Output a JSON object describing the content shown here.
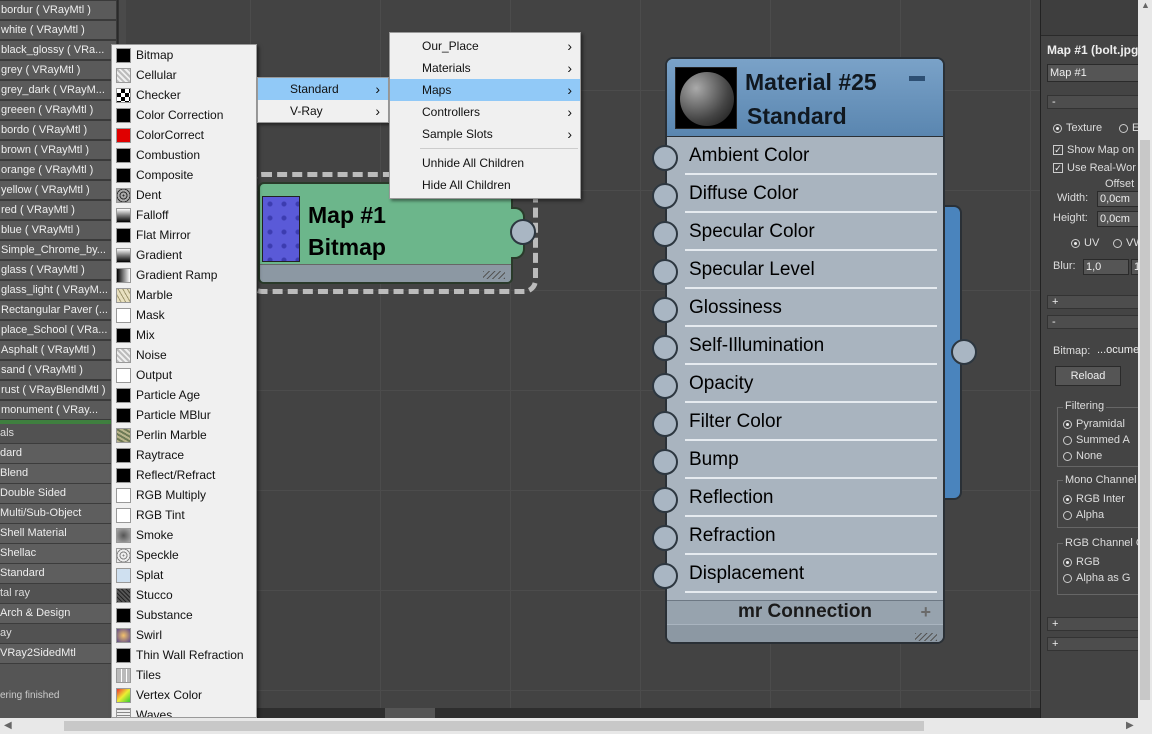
{
  "left_list": {
    "materials": [
      "bordur  ( VRayMtl )",
      "white  ( VRayMtl )",
      "black_glossy  ( VRa...",
      "grey  ( VRayMtl )",
      "grey_dark  ( VRayM...",
      "greeen  ( VRayMtl )",
      "bordo  ( VRayMtl )",
      "brown  ( VRayMtl )",
      "orange  ( VRayMtl )",
      "yellow  ( VRayMtl )",
      "red  ( VRayMtl )",
      "blue  ( VRayMtl )",
      "Simple_Chrome_by...",
      "glass  ( VRayMtl )",
      "glass_light  ( VRayM...",
      "Rectangular Paver  (...",
      "place_School  ( VRa...",
      "Asphalt  ( VRayMtl )",
      "sand  ( VRayMtl )",
      "rust  ( VRayBlendMtl )",
      "monument  ( VRay..."
    ],
    "categories": [
      {
        "label": "als",
        "sub": false
      },
      {
        "label": "dard",
        "sub": true
      },
      {
        "label": "Blend",
        "sub": true
      },
      {
        "label": "Double Sided",
        "sub": true
      },
      {
        "label": "Multi/Sub-Object",
        "sub": true
      },
      {
        "label": "Shell Material",
        "sub": true
      },
      {
        "label": "Shellac",
        "sub": true
      },
      {
        "label": "Standard",
        "sub": true
      },
      {
        "label": "tal ray",
        "sub": false
      },
      {
        "label": "Arch & Design",
        "sub": true
      },
      {
        "label": "ay",
        "sub": false
      },
      {
        "label": "VRay2SidedMtl",
        "sub": true
      }
    ],
    "status": "ering finished"
  },
  "maps_menu": [
    {
      "label": "Bitmap",
      "swatch": "black"
    },
    {
      "label": "Cellular",
      "swatch": "noise"
    },
    {
      "label": "Checker",
      "swatch": "checker"
    },
    {
      "label": "Color Correction",
      "swatch": "black"
    },
    {
      "label": "ColorCorrect",
      "swatch": "red"
    },
    {
      "label": "Combustion",
      "swatch": "black"
    },
    {
      "label": "Composite",
      "swatch": "black"
    },
    {
      "label": "Dent",
      "swatch": "dent"
    },
    {
      "label": "Falloff",
      "swatch": "gradv"
    },
    {
      "label": "Flat Mirror",
      "swatch": "black"
    },
    {
      "label": "Gradient",
      "swatch": "gradv"
    },
    {
      "label": "Gradient Ramp",
      "swatch": "grad"
    },
    {
      "label": "Marble",
      "swatch": "marble"
    },
    {
      "label": "Mask",
      "swatch": "mask"
    },
    {
      "label": "Mix",
      "swatch": "black"
    },
    {
      "label": "Noise",
      "swatch": "noise"
    },
    {
      "label": "Output",
      "swatch": "white"
    },
    {
      "label": "Particle Age",
      "swatch": "black"
    },
    {
      "label": "Particle MBlur",
      "swatch": "black"
    },
    {
      "label": "Perlin Marble",
      "swatch": "perlin"
    },
    {
      "label": "Raytrace",
      "swatch": "black"
    },
    {
      "label": "Reflect/Refract",
      "swatch": "black"
    },
    {
      "label": "RGB Multiply",
      "swatch": "white"
    },
    {
      "label": "RGB Tint",
      "swatch": "white"
    },
    {
      "label": "Smoke",
      "swatch": "smoke"
    },
    {
      "label": "Speckle",
      "swatch": "speckle"
    },
    {
      "label": "Splat",
      "swatch": "splat"
    },
    {
      "label": "Stucco",
      "swatch": "stucco"
    },
    {
      "label": "Substance",
      "swatch": "black"
    },
    {
      "label": "Swirl",
      "swatch": "swirl"
    },
    {
      "label": "Thin Wall Refraction",
      "swatch": "black"
    },
    {
      "label": "Tiles",
      "swatch": "tiles"
    },
    {
      "label": "Vertex Color",
      "swatch": "vertex"
    },
    {
      "label": "Waves",
      "swatch": "waves"
    }
  ],
  "submenu_category": [
    {
      "label": "Standard",
      "highlighted": true
    },
    {
      "label": "V-Ray",
      "highlighted": false
    }
  ],
  "context_menu": {
    "items": [
      {
        "label": "Our_Place",
        "highlighted": false
      },
      {
        "label": "Materials",
        "highlighted": false
      },
      {
        "label": "Maps",
        "highlighted": true
      },
      {
        "label": "Controllers",
        "highlighted": false
      },
      {
        "label": "Sample Slots",
        "highlighted": false
      }
    ],
    "actions": [
      "Unhide All Children",
      "Hide All Children"
    ]
  },
  "material_node": {
    "title": "Material #25",
    "type": "Standard",
    "slots": [
      "Ambient Color",
      "Diffuse Color",
      "Specular Color",
      "Specular Level",
      "Glossiness",
      "Self-Illumination",
      "Opacity",
      "Filter Color",
      "Bump",
      "Reflection",
      "Refraction",
      "Displacement"
    ],
    "footer_label": "mr Connection",
    "footer_plus": "+",
    "minimize": "—"
  },
  "bitmap_node": {
    "title": "Map #1",
    "type": "Bitmap"
  },
  "right_panel": {
    "title": "Map #1 (bolt.jpg",
    "name_value": "Map #1",
    "rollout_minus_1": "-",
    "rollout_minus_2": "-",
    "rollout_plus_1": "+",
    "rollout_plus_2": "+",
    "rollout_plus_3": "+",
    "texture_label": "Texture",
    "env_label": "E",
    "show_map_label": "Show Map on",
    "use_real_world_label": "Use Real-Wor",
    "offset_label": "Offset",
    "width_label": "Width:",
    "width_value": "0,0cm",
    "height_label": "Height:",
    "height_value": "0,0cm",
    "uv_label": "UV",
    "vw_label": "VW",
    "blur_label": "Blur:",
    "blur_value": "1,0",
    "blur_offset": "1",
    "bitmap_label": "Bitmap:",
    "bitmap_value": "...ocume",
    "reload_label": "Reload",
    "filtering_label": "Filtering",
    "filtering_options": [
      "Pyramidal",
      "Summed A",
      "None"
    ],
    "mono_label": "Mono Channel",
    "mono_options": [
      "RGB Inter",
      "Alpha"
    ],
    "rgb_channel_label": "RGB Channel O",
    "rgb_options": [
      "RGB",
      "Alpha as G"
    ]
  },
  "scrollbars": {
    "left_arrow": "◀",
    "right_arrow": "▶",
    "up_arrow": "▲"
  },
  "colors": {
    "menu_highlight": "#91c9f7",
    "material_header": "#5a86b0",
    "bitmap_node": "#6cb68b",
    "canvas": "#434343"
  }
}
